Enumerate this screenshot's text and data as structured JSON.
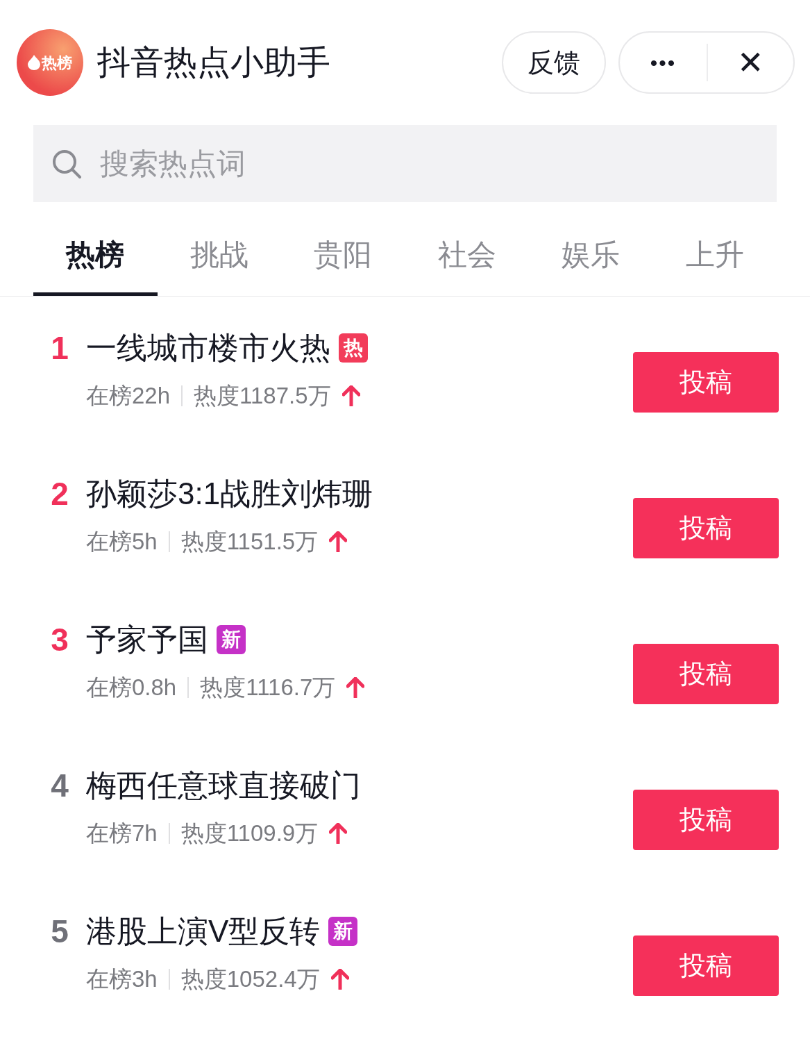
{
  "header": {
    "logo_text": "热榜",
    "title": "抖音热点小助手",
    "feedback_button": "反馈",
    "more_button": "•••",
    "close_button": "✕"
  },
  "search": {
    "placeholder": "搜索热点词"
  },
  "tabs": [
    {
      "label": "热榜",
      "selected": true
    },
    {
      "label": "挑战",
      "selected": false
    },
    {
      "label": "贵阳",
      "selected": false
    },
    {
      "label": "社会",
      "selected": false
    },
    {
      "label": "娱乐",
      "selected": false
    },
    {
      "label": "上升",
      "selected": false
    }
  ],
  "items": [
    {
      "rank": "1",
      "top": true,
      "title": "一线城市楼市火热",
      "badge": {
        "kind": "hot",
        "text": "热"
      },
      "duration": "在榜22h",
      "heat": "热度1187.5万",
      "button": "投稿"
    },
    {
      "rank": "2",
      "top": true,
      "title": "孙颖莎3:1战胜刘炜珊",
      "duration": "在榜5h",
      "heat": "热度1151.5万",
      "button": "投稿"
    },
    {
      "rank": "3",
      "top": true,
      "title": "予家予国",
      "badge": {
        "kind": "new",
        "text": "新"
      },
      "duration": "在榜0.8h",
      "heat": "热度1116.7万",
      "button": "投稿"
    },
    {
      "rank": "4",
      "top": false,
      "title": "梅西任意球直接破门",
      "duration": "在榜7h",
      "heat": "热度1109.9万",
      "button": "投稿"
    },
    {
      "rank": "5",
      "top": false,
      "title": "港股上演V型反转",
      "badge": {
        "kind": "new",
        "text": "新"
      },
      "duration": "在榜3h",
      "heat": "热度1052.4万",
      "button": "投稿"
    }
  ]
}
